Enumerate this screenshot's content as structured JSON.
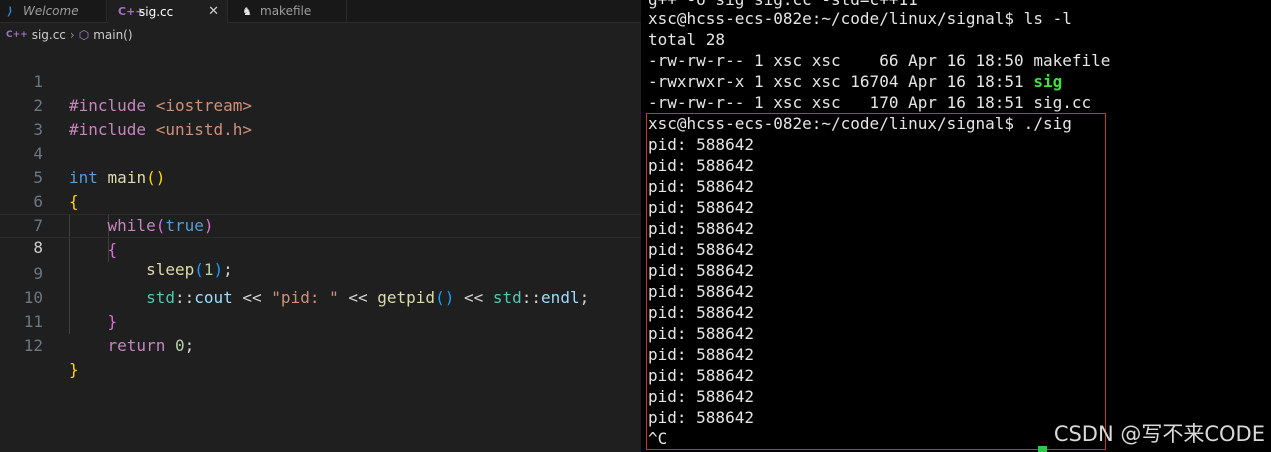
{
  "editor": {
    "tabs": [
      {
        "label": "Welcome",
        "icon": "vscode-logo-icon"
      },
      {
        "label": "sig.cc",
        "icon": "cpp-file-icon"
      },
      {
        "label": "makefile",
        "icon": "makefile-icon"
      }
    ],
    "close_glyph": "✕",
    "breadcrumb": {
      "file": "sig.cc",
      "symbol": "main()"
    },
    "active_line": 8,
    "line_numbers": [
      "1",
      "2",
      "3",
      "4",
      "5",
      "6",
      "7",
      "8",
      "9",
      "10",
      "11",
      "12"
    ],
    "code": {
      "l1": {
        "kw": "#include",
        "arg": " <iostream>"
      },
      "l2": {
        "kw": "#include",
        "arg": " <unistd.h>"
      },
      "l4": {
        "type": "int",
        "name": "main",
        "open": "(",
        "close": ")"
      },
      "l5": {
        "brace": "{"
      },
      "l6": {
        "kw": "while",
        "open": "(",
        "val": "true",
        "close": ")"
      },
      "l7": {
        "brace": "{"
      },
      "l8": {
        "fn": "sleep",
        "open": "(",
        "num": "1",
        "close": ")",
        "end": ";"
      },
      "l9": {
        "ns1": "std",
        "sep1": "::",
        "var1": "cout",
        "op1": " << ",
        "str": "\"pid: \"",
        "op2": " << ",
        "fn": "getpid",
        "open": "(",
        "close": ")",
        "op3": " << ",
        "ns2": "std",
        "sep2": "::",
        "var2": "endl",
        "end": ";"
      },
      "l10": {
        "brace": "}"
      },
      "l11": {
        "kw": "return",
        "num": " 0",
        "end": ";"
      },
      "l12": {
        "brace": "}"
      }
    }
  },
  "terminal": {
    "partial_top": "g++ -o sig sig.cc -std=c++11",
    "prompt1": "xsc@hcss-ecs-082e:~/code/linux/signal$ ls -l",
    "total": "total 28",
    "files": [
      {
        "meta": "-rw-rw-r-- 1 xsc xsc    66 Apr 16 18:50 ",
        "name": "makefile",
        "exec": false
      },
      {
        "meta": "-rwxrwxr-x 1 xsc xsc 16704 Apr 16 18:51 ",
        "name": "sig",
        "exec": true
      },
      {
        "meta": "-rw-rw-r-- 1 xsc xsc   170 Apr 16 18:51 ",
        "name": "sig.cc",
        "exec": false
      }
    ],
    "prompt2": "xsc@hcss-ecs-082e:~/code/linux/signal$ ./sig",
    "pid_lines": [
      "pid: 588642",
      "pid: 588642",
      "pid: 588642",
      "pid: 588642",
      "pid: 588642",
      "pid: 588642",
      "pid: 588642",
      "pid: 588642",
      "pid: 588642",
      "pid: 588642",
      "pid: 588642",
      "pid: 588642",
      "pid: 588642",
      "pid: 588642"
    ],
    "interrupt": "^C"
  },
  "watermark": "CSDN @写不来CODE",
  "colors": {
    "editor_bg": "#1f1f1f",
    "terminal_bg": "#000000",
    "highlight_box": "#c0392b",
    "exec_file": "#3ee03e"
  }
}
